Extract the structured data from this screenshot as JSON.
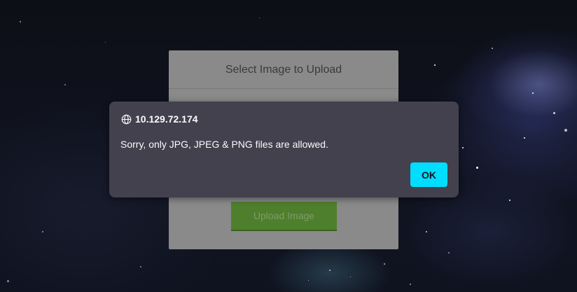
{
  "background": {
    "description_icon": "starfield-background"
  },
  "upload_card": {
    "title": "Select Image to Upload",
    "button_label": "Upload Image",
    "button_color": "#4e7f2c"
  },
  "alert": {
    "origin_icon": "globe-icon",
    "origin": "10.129.72.174",
    "message": "Sorry, only JPG, JPEG & PNG files are allowed.",
    "ok_label": "OK",
    "ok_color": "#00ddff",
    "background_color": "#42414d"
  }
}
